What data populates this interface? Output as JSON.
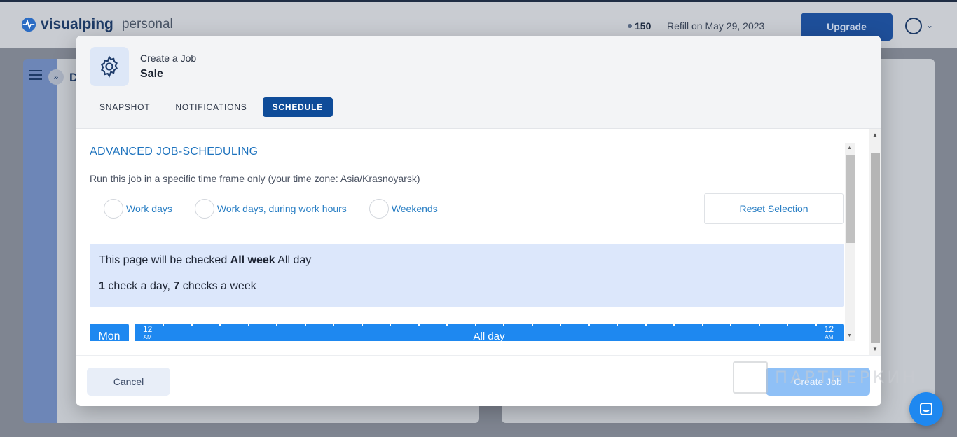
{
  "app": {
    "brand": "visualping",
    "plan": "personal",
    "credits": "150",
    "refill": "Refill on May 29, 2023",
    "upgrade_label": "Upgrade",
    "background_letter": "D"
  },
  "modal": {
    "kicker": "Create a Job",
    "job_name": "Sale",
    "tabs": [
      {
        "label": "SNAPSHOT",
        "active": false
      },
      {
        "label": "NOTIFICATIONS",
        "active": false
      },
      {
        "label": "SCHEDULE",
        "active": true
      }
    ],
    "schedule": {
      "title": "ADVANCED JOB-SCHEDULING",
      "description": "Run this job in a specific time frame only (your time zone: Asia/Krasnoyarsk)",
      "presets": [
        {
          "label": "Work days",
          "selected": false
        },
        {
          "label": "Work days, during work hours",
          "selected": false
        },
        {
          "label": "Weekends",
          "selected": false
        }
      ],
      "reset_label": "Reset Selection",
      "summary": {
        "line1_prefix": "This page will be checked ",
        "line1_bold": "All week",
        "line1_suffix": " All day",
        "checks_per_day": "1",
        "checks_per_day_text": " check a day, ",
        "checks_per_week": "7",
        "checks_per_week_text": " checks a week"
      },
      "days": [
        {
          "label": "Mon",
          "bar_text": "All day",
          "start_hour": "12",
          "start_meridiem": "AM",
          "end_hour": "12",
          "end_meridiem": "AM"
        }
      ]
    },
    "cancel_label": "Cancel",
    "create_label": "Create Job"
  },
  "watermark": "ПАРТНЕРКИН",
  "colors": {
    "accent": "#0f4c99",
    "link": "#2a7fc4",
    "bar": "#1e88f0",
    "summary_bg": "#dce7fb"
  }
}
